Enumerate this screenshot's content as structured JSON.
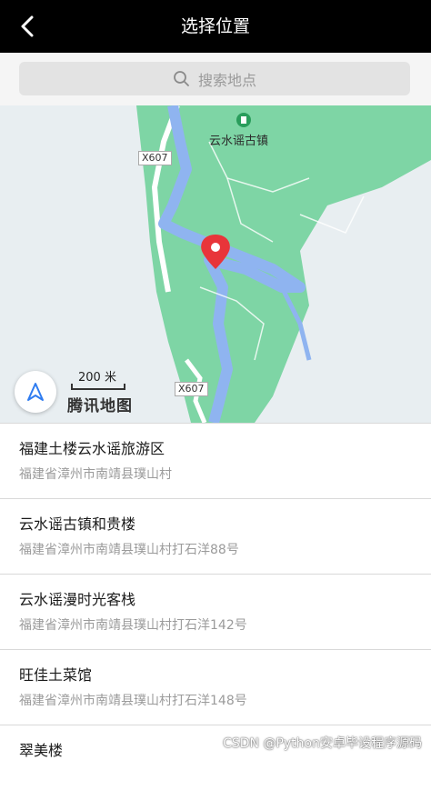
{
  "header": {
    "title": "选择位置"
  },
  "search": {
    "placeholder": "搜索地点"
  },
  "map": {
    "poi_label": "云水谣古镇",
    "road_badge_top": "X607",
    "road_badge_bottom": "X607",
    "scale_label": "200 米",
    "logo_text": "腾讯地图",
    "colors": {
      "land": "#7ed5a5",
      "water": "#8fb4f0",
      "background": "#e8eef1",
      "pin": "#e8353a"
    }
  },
  "places": [
    {
      "name": "福建土楼云水谣旅游区",
      "address": "福建省漳州市南靖县璞山村"
    },
    {
      "name": "云水谣古镇和贵楼",
      "address": "福建省漳州市南靖县璞山村打石洋88号"
    },
    {
      "name": "云水谣漫时光客栈",
      "address": "福建省漳州市南靖县璞山村打石洋142号"
    },
    {
      "name": "旺佳土菜馆",
      "address": "福建省漳州市南靖县璞山村打石洋148号"
    },
    {
      "name": "翠美楼",
      "address": ""
    }
  ],
  "watermark": "CSDN @Python安卓毕设程序源码"
}
